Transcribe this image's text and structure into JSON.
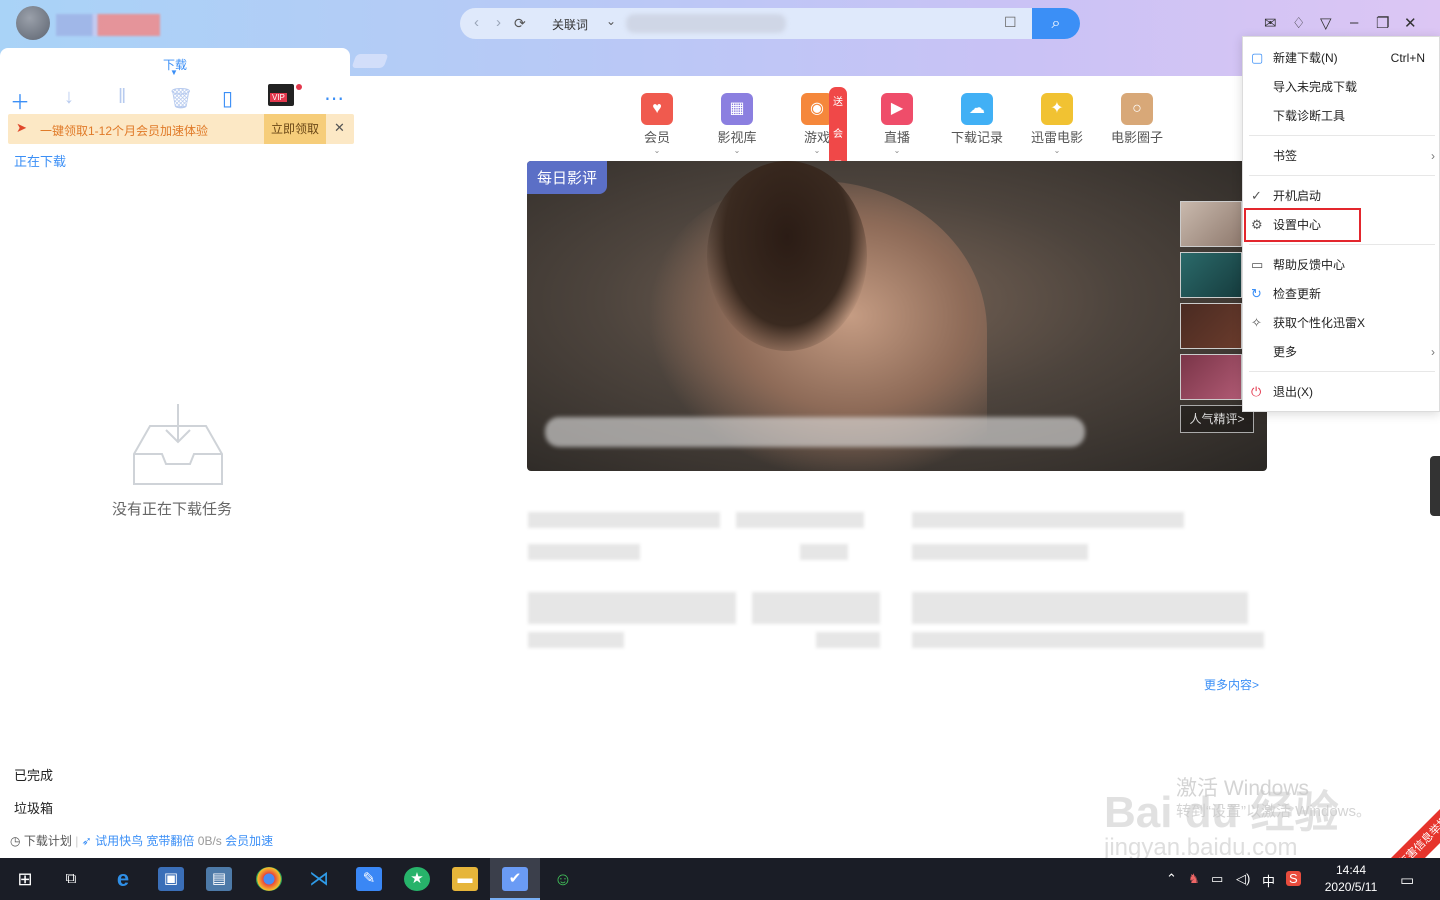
{
  "addressbar": {
    "keyword_label": "关联词",
    "search_placeholder": ""
  },
  "left_panel": {
    "tab_label": "下载",
    "promo": {
      "text": "一键领取1-12个月会员加速体验",
      "button": "立即领取"
    },
    "vip_badge": "VIP",
    "downloading_label": "正在下载",
    "empty_text": "没有正在下载任务",
    "completed_label": "已完成",
    "trash_label": "垃圾箱",
    "footer": {
      "plan": "下载计划",
      "trial": "试用快鸟",
      "boost": "宽带翻倍",
      "speed": "0B/s",
      "member_boost": "会员加速"
    }
  },
  "nav_icons": [
    {
      "label": "会员",
      "color": "#f05a4e"
    },
    {
      "label": "影视库",
      "color": "#8b7fe0"
    },
    {
      "label": "游戏",
      "color": "#f5873b",
      "badge": "送会员"
    },
    {
      "label": "直播",
      "color": "#ef4d6a"
    },
    {
      "label": "下载记录",
      "color": "#41b0f5"
    },
    {
      "label": "迅雷电影",
      "color": "#f1c232"
    },
    {
      "label": "电影圈子",
      "color": "#d8a878"
    }
  ],
  "banner": {
    "tag": "每日影评",
    "hot_reviews": "人气精评>"
  },
  "more_content": "更多内容>",
  "menu": {
    "items": [
      {
        "label": "新建下载(N)",
        "shortcut": "Ctrl+N",
        "icon": "new-download-icon"
      },
      {
        "label": "导入未完成下载"
      },
      {
        "label": "下载诊断工具"
      },
      {
        "label": "书签",
        "submenu": true
      },
      {
        "label": "开机启动",
        "checked": true
      },
      {
        "label": "设置中心",
        "icon": "gear-icon"
      },
      {
        "label": "帮助反馈中心",
        "icon": "feedback-icon"
      },
      {
        "label": "检查更新",
        "icon": "update-icon"
      },
      {
        "label": "获取个性化迅雷X",
        "icon": "magic-wand-icon"
      },
      {
        "label": "更多",
        "submenu": true
      },
      {
        "label": "退出(X)",
        "icon": "power-icon"
      }
    ]
  },
  "watermark": {
    "line1": "激活 Windows",
    "line2": "转到“设置”以激活 Windows。",
    "brand": "Bai du 经验",
    "url": "jingyan.baidu.com"
  },
  "corner_badge": "有害信息举报",
  "taskbar": {
    "time": "14:44",
    "date": "2020/5/11",
    "ime": "中"
  }
}
